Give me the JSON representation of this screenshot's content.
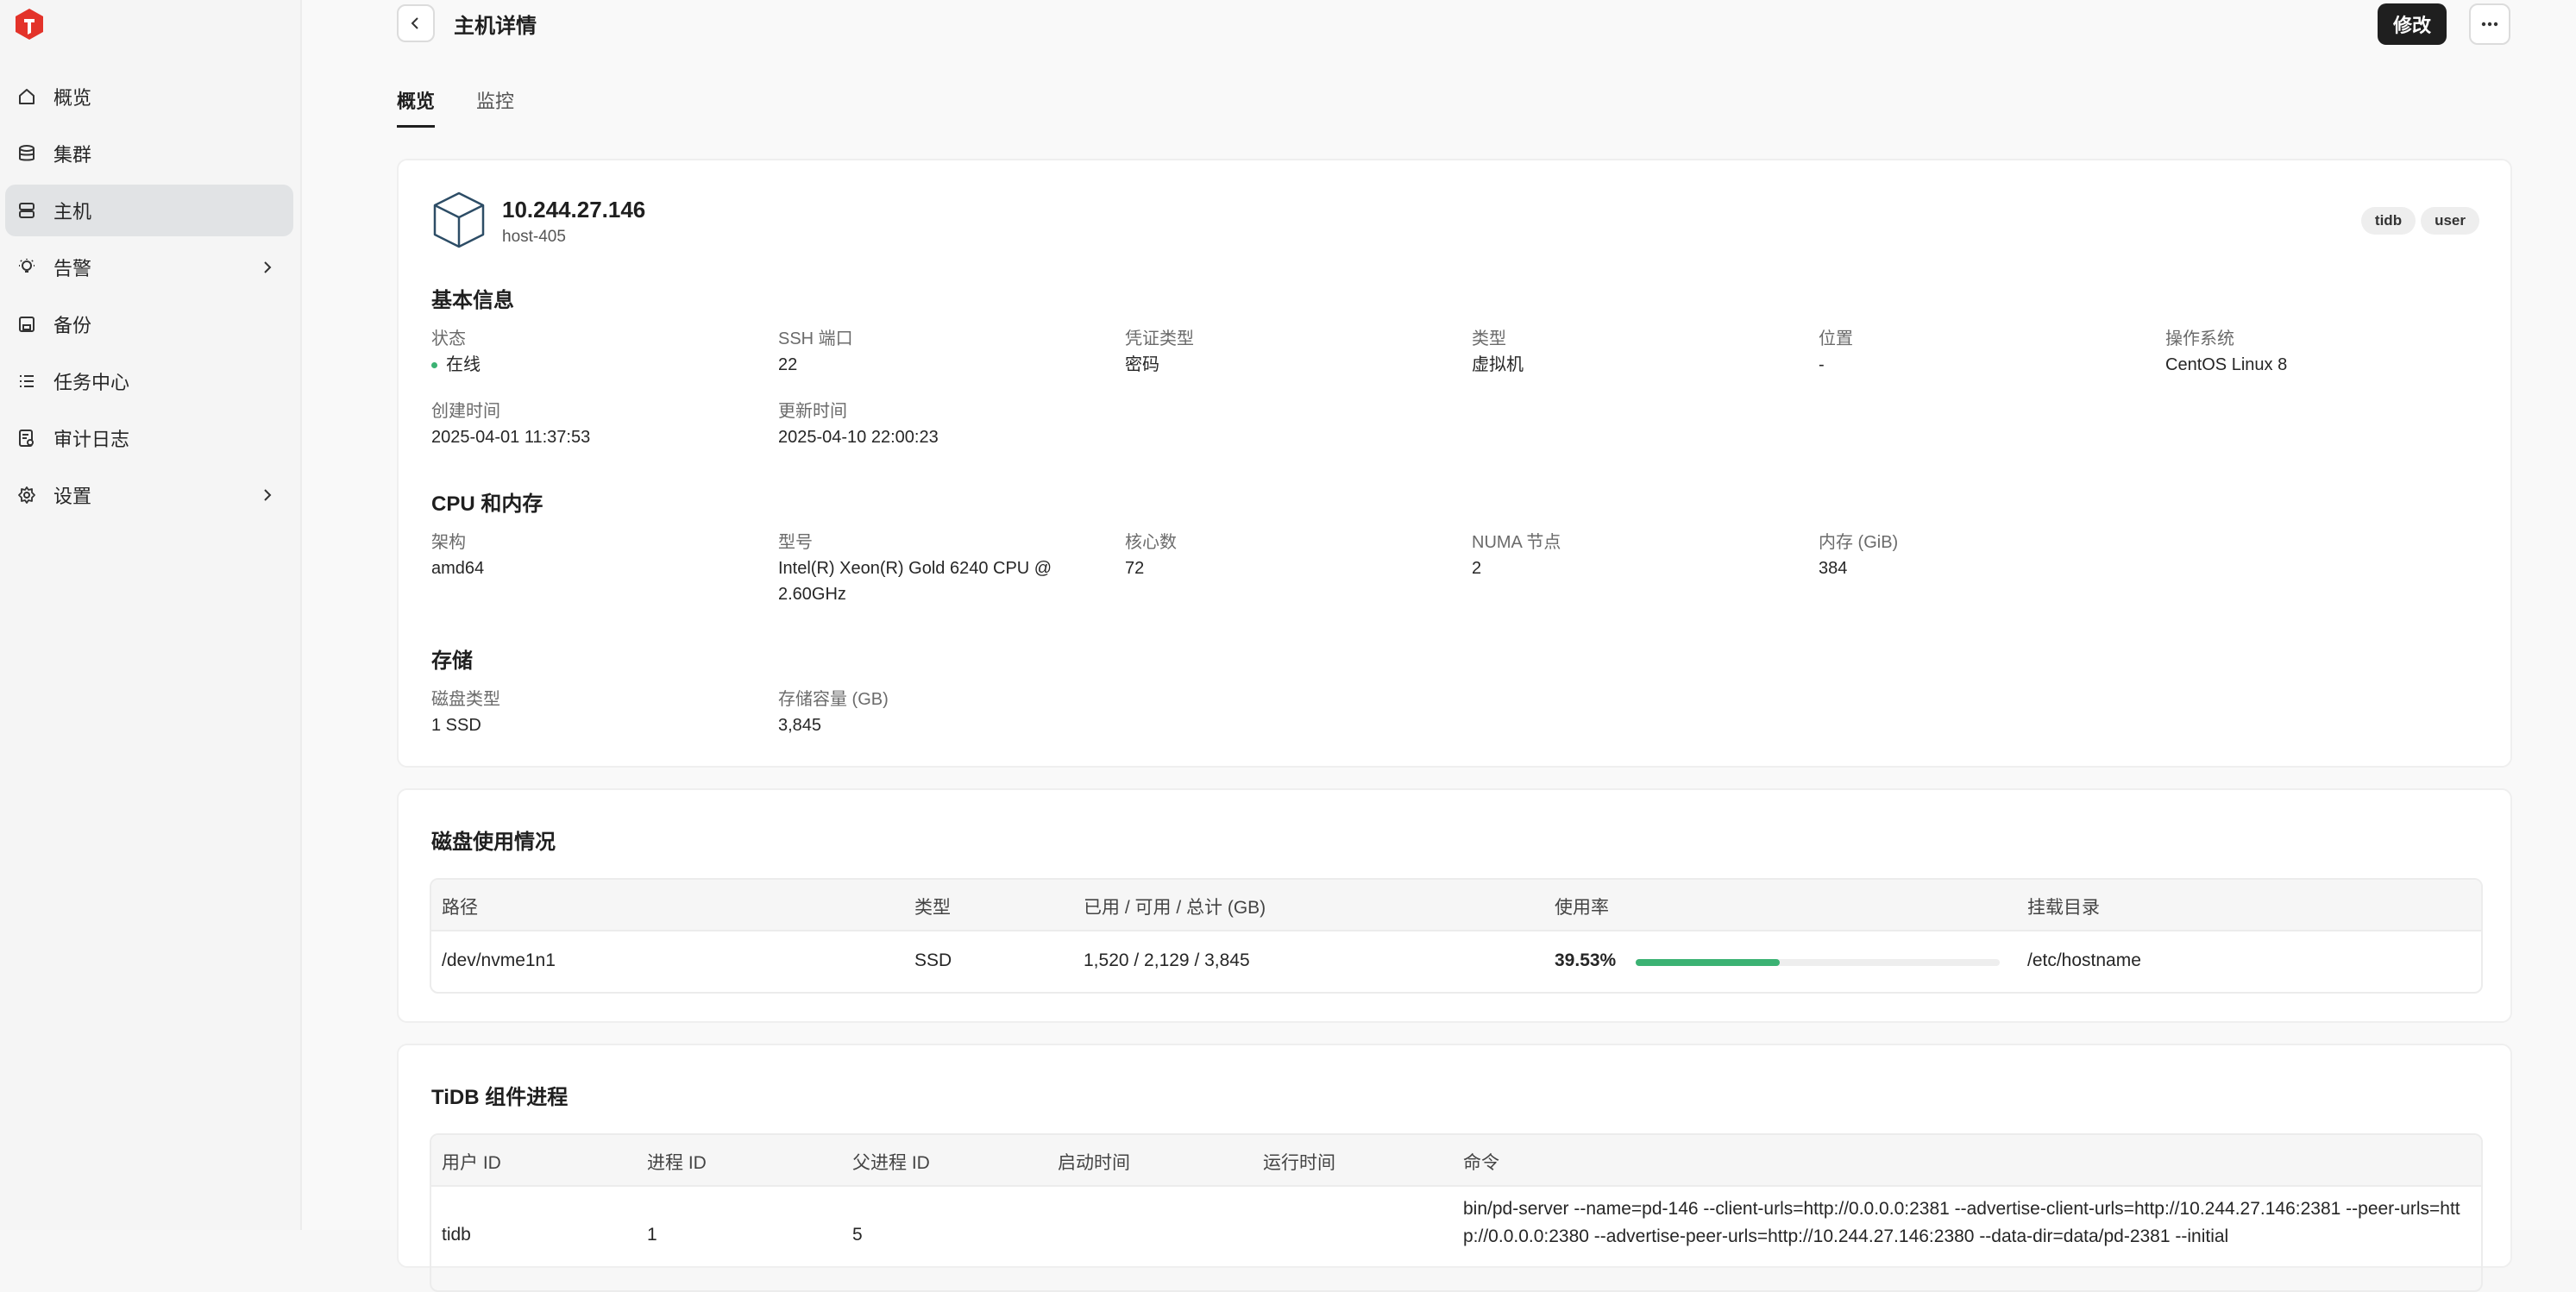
{
  "sidebar": {
    "items": [
      {
        "label": "概览",
        "icon": "home-icon"
      },
      {
        "label": "集群",
        "icon": "database-icon"
      },
      {
        "label": "主机",
        "icon": "server-icon",
        "active": true
      },
      {
        "label": "告警",
        "icon": "bulb-icon",
        "expandable": true
      },
      {
        "label": "备份",
        "icon": "save-icon"
      },
      {
        "label": "任务中心",
        "icon": "list-icon"
      },
      {
        "label": "审计日志",
        "icon": "audit-log-icon"
      },
      {
        "label": "设置",
        "icon": "gear-icon",
        "expandable": true
      }
    ]
  },
  "header": {
    "title": "主机详情",
    "edit_label": "修改"
  },
  "tabs": [
    {
      "label": "概览",
      "active": true
    },
    {
      "label": "监控",
      "active": false
    }
  ],
  "host": {
    "ip": "10.244.27.146",
    "name": "host-405",
    "tags": [
      "tidb",
      "user"
    ]
  },
  "basic": {
    "title": "基本信息",
    "status_label": "状态",
    "status_value": "在线",
    "ssh_label": "SSH 端口",
    "ssh_value": "22",
    "cred_label": "凭证类型",
    "cred_value": "密码",
    "type_label": "类型",
    "type_value": "虚拟机",
    "location_label": "位置",
    "location_value": "-",
    "os_label": "操作系统",
    "os_value": "CentOS Linux 8",
    "created_label": "创建时间",
    "created_value": "2025-04-01 11:37:53",
    "updated_label": "更新时间",
    "updated_value": "2025-04-10 22:00:23"
  },
  "cpu": {
    "title": "CPU 和内存",
    "arch_label": "架构",
    "arch_value": "amd64",
    "model_label": "型号",
    "model_value": "Intel(R) Xeon(R) Gold 6240 CPU @ 2.60GHz",
    "cores_label": "核心数",
    "cores_value": "72",
    "numa_label": "NUMA 节点",
    "numa_value": "2",
    "mem_label": "内存 (GiB)",
    "mem_value": "384"
  },
  "storage": {
    "title": "存储",
    "disk_type_label": "磁盘类型",
    "disk_type_value": "1 SSD",
    "capacity_label": "存储容量 (GB)",
    "capacity_value": "3,845"
  },
  "disk_usage": {
    "title": "磁盘使用情况",
    "columns": [
      "路径",
      "类型",
      "已用 / 可用 / 总计 (GB)",
      "使用率",
      "挂载目录"
    ],
    "rows": [
      {
        "path": "/dev/nvme1n1",
        "type": "SSD",
        "usage": "1,520 / 2,129 / 3,845",
        "rate": "39.53%",
        "rate_value": 0.3953,
        "mount": "/etc/hostname"
      }
    ]
  },
  "processes": {
    "title": "TiDB 组件进程",
    "columns": [
      "用户 ID",
      "进程 ID",
      "父进程 ID",
      "启动时间",
      "运行时间",
      "命令"
    ],
    "rows": [
      {
        "user": "tidb",
        "pid": "1",
        "ppid": "5",
        "start": "",
        "uptime": "",
        "command": "bin/pd-server --name=pd-146 --client-urls=http://0.0.0.0:2381 --advertise-client-urls=http://10.244.27.146:2381 --peer-urls=http://0.0.0.0:2380 --advertise-peer-urls=http://10.244.27.146:2380 --data-dir=data/pd-2381 --initial"
      }
    ]
  },
  "colors": {
    "accent": "#1f1f1f",
    "online": "#3bb273",
    "progress": "#3bb273"
  }
}
